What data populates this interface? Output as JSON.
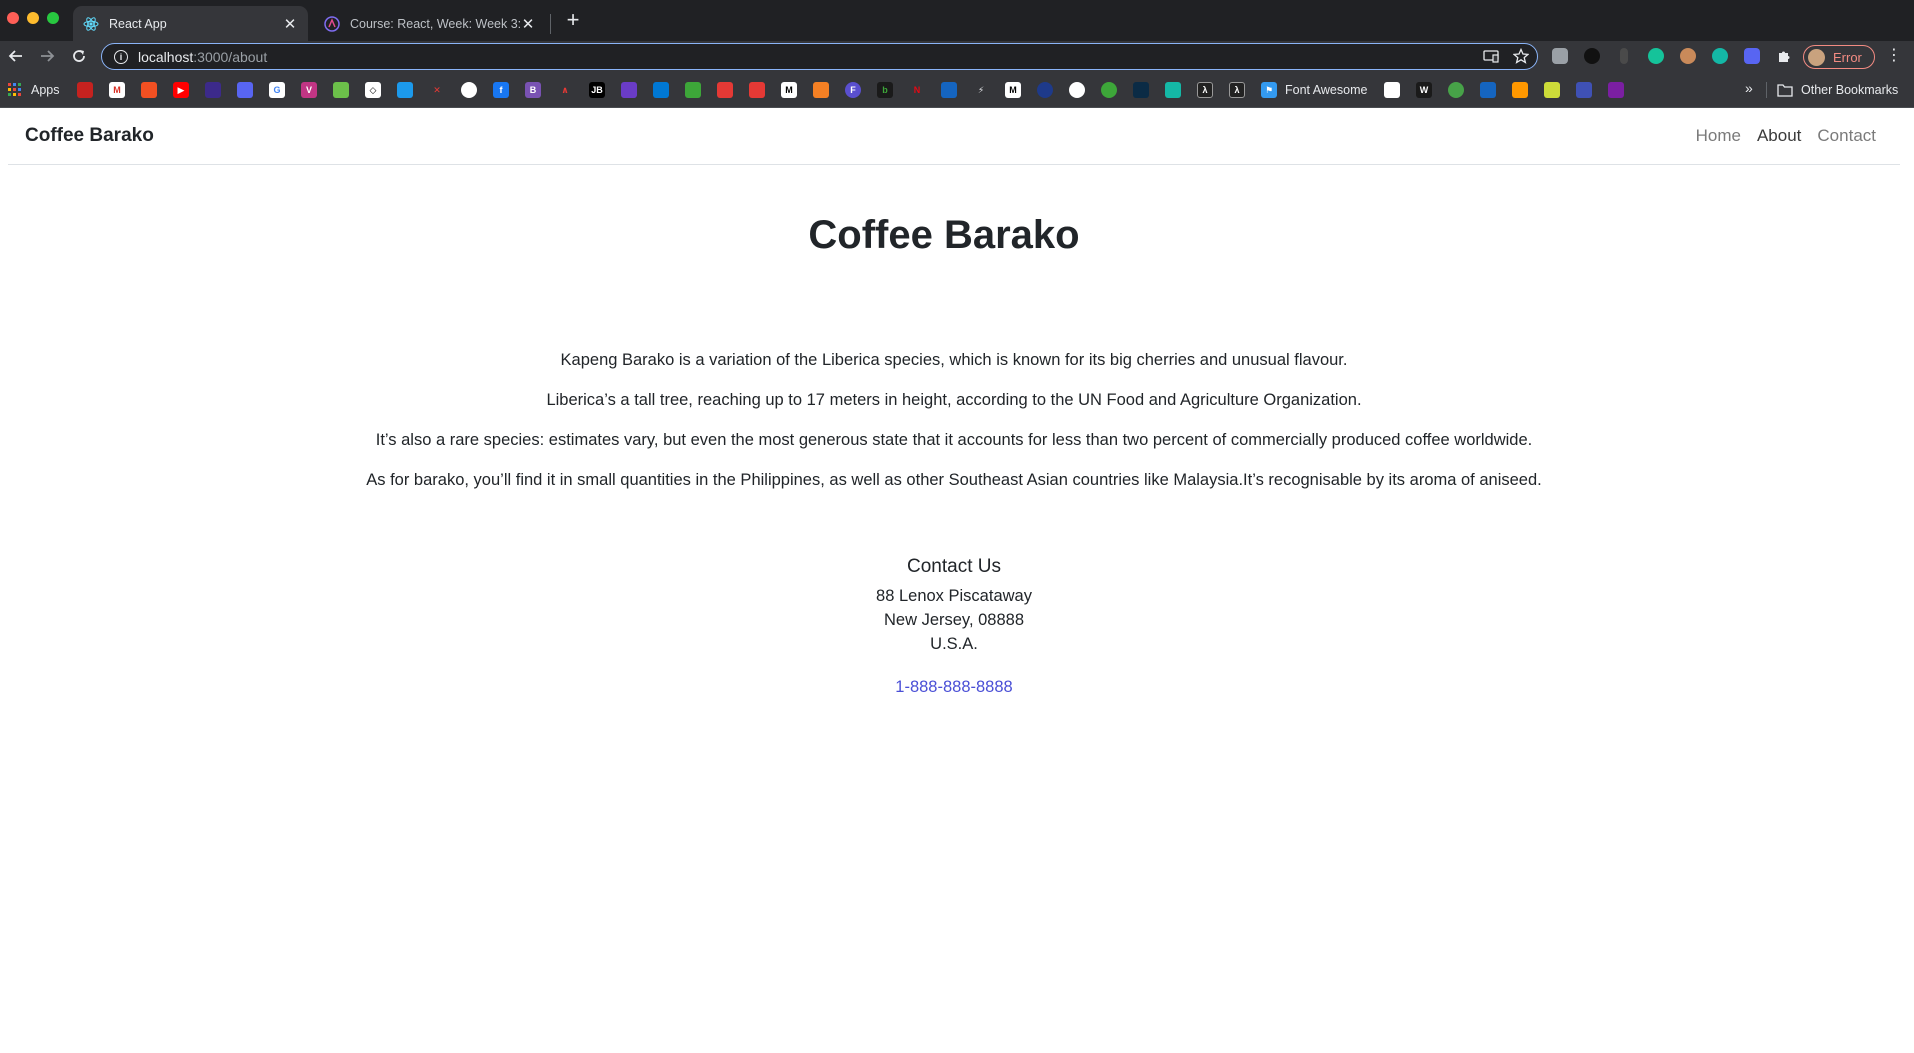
{
  "browser": {
    "tabs": [
      {
        "title": "React App",
        "active": true
      },
      {
        "title": "Course: React, Week: Week 3:",
        "active": false
      }
    ],
    "url_host": "localhost",
    "url_path": ":3000/about",
    "profile_label": "Error",
    "bookmarks": {
      "apps_label": "Apps",
      "font_awesome_label": "Font Awesome",
      "other_label": "Other Bookmarks"
    }
  },
  "site": {
    "brand": "Coffee Barako",
    "nav": {
      "home": "Home",
      "about": "About",
      "contact": "Contact"
    },
    "title": "Coffee Barako",
    "paragraphs": [
      "Kapeng Barako is a variation of the Liberica species, which is known for its big cherries and unusual flavour.",
      "Liberica’s a tall tree, reaching up to 17 meters in height, according to the UN Food and Agriculture Organization.",
      "It’s also a rare species: estimates vary, but even the most generous state that it accounts for less than two percent of commercially produced coffee worldwide.",
      "As for barako, you’ll find it in small quantities in the Philippines, as well as other Southeast Asian countries like Malaysia.It’s recognisable by its aroma of aniseed."
    ],
    "contact": {
      "title": "Contact Us",
      "address_line1": "88 Lenox Piscataway",
      "address_line2": "New Jersey, 08888",
      "address_line3": "U.S.A.",
      "phone": "1-888-888-8888"
    }
  },
  "colors": {
    "link": "#4a4fd6",
    "chrome_dark": "#202124",
    "chrome_toolbar": "#35363a"
  }
}
